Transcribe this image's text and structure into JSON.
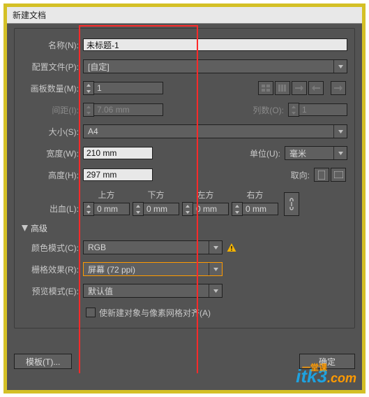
{
  "dialog": {
    "title": "新建文档",
    "name_label": "名称(N):",
    "name_value": "未标题-1",
    "profile_label": "配置文件(P):",
    "profile_value": "[自定]",
    "artboards_label": "画板数量(M):",
    "artboards_value": "1",
    "spacing_label": "间距(I):",
    "spacing_value": "7.06 mm",
    "columns_label": "列数(O):",
    "columns_value": "1",
    "size_label": "大小(S):",
    "size_value": "A4",
    "width_label": "宽度(W):",
    "width_value": "210 mm",
    "units_label": "单位(U):",
    "units_value": "毫米",
    "height_label": "高度(H):",
    "height_value": "297 mm",
    "orient_label": "取向:",
    "bleed_label": "出血(L):",
    "bleed": {
      "top_label": "上方",
      "top_value": "0 mm",
      "bottom_label": "下方",
      "bottom_value": "0 mm",
      "left_label": "左方",
      "left_value": "0 mm",
      "right_label": "右方",
      "right_value": "0 mm"
    },
    "adv_header": "高级",
    "color_label": "颜色模式(C):",
    "color_value": "RGB",
    "raster_label": "栅格效果(R):",
    "raster_value": "屏幕 (72 ppi)",
    "preview_label": "预览模式(E):",
    "preview_value": "默认值",
    "align_label": "使新建对象与像素网格对齐(A)",
    "templates_btn": "模板(T)...",
    "ok_btn": "确定"
  },
  "watermark": {
    "a": "itk",
    "b": "3",
    "c": "一堂课",
    "d": ".com"
  }
}
